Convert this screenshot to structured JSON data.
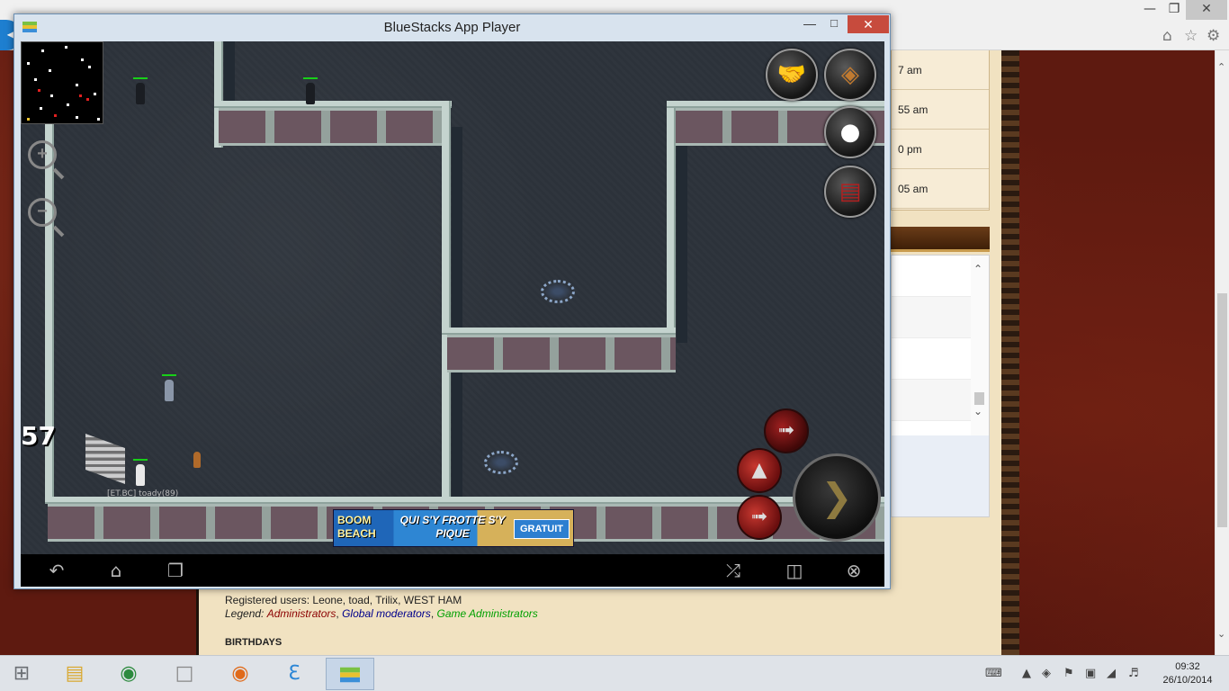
{
  "background_browser": {
    "times": [
      "7 am",
      "55 am",
      "0 pm",
      "05 am"
    ],
    "forum": {
      "registered_label": "Registered users:",
      "registered_users": "Leone, toad, Trilix, WEST HAM",
      "legend_label": "Legend:",
      "legend_admin": "Administrators",
      "legend_sep1": ", ",
      "legend_gmod": "Global moderators",
      "legend_sep2": ", ",
      "legend_game": "Game Administrators",
      "birthdays": "BIRTHDAYS"
    }
  },
  "bluestacks": {
    "title": "BlueStacks App Player",
    "game": {
      "level_number": "57",
      "player_name": "[ET.BC] toady(89)",
      "ad": {
        "line1": "BOOM",
        "line2": "BEACH",
        "slogan": "QUI S'Y FROTTE S'Y PIQUE",
        "cta": "GRATUIT"
      }
    }
  },
  "taskbar": {
    "clock_time": "09:32",
    "clock_date": "26/10/2014"
  },
  "colors": {
    "bluestacks_close": "#c74b3d",
    "hp_bar": "#18d018",
    "parchment": "#f1e2c1",
    "legend_admin": "#8b0000",
    "legend_gmod": "#00008b",
    "legend_game": "#00a000"
  },
  "icons": {
    "window_minimize": "minimize-icon",
    "window_restore": "restore-icon",
    "window_close": "close-icon",
    "home": "home-icon",
    "favorites": "star-icon",
    "settings": "gear-icon",
    "zoom_in": "zoom-in-icon",
    "zoom_out": "zoom-out-icon",
    "trade": "handshake-icon",
    "inventory": "bag-icon",
    "chat": "speech-bubble-icon",
    "quest_book": "book-icon",
    "android_back": "back-arrow-icon",
    "android_home": "android-home-icon",
    "android_recent": "recent-apps-icon",
    "share": "share-icon",
    "rotate": "rotate-icon",
    "exit": "circle-x-icon"
  }
}
